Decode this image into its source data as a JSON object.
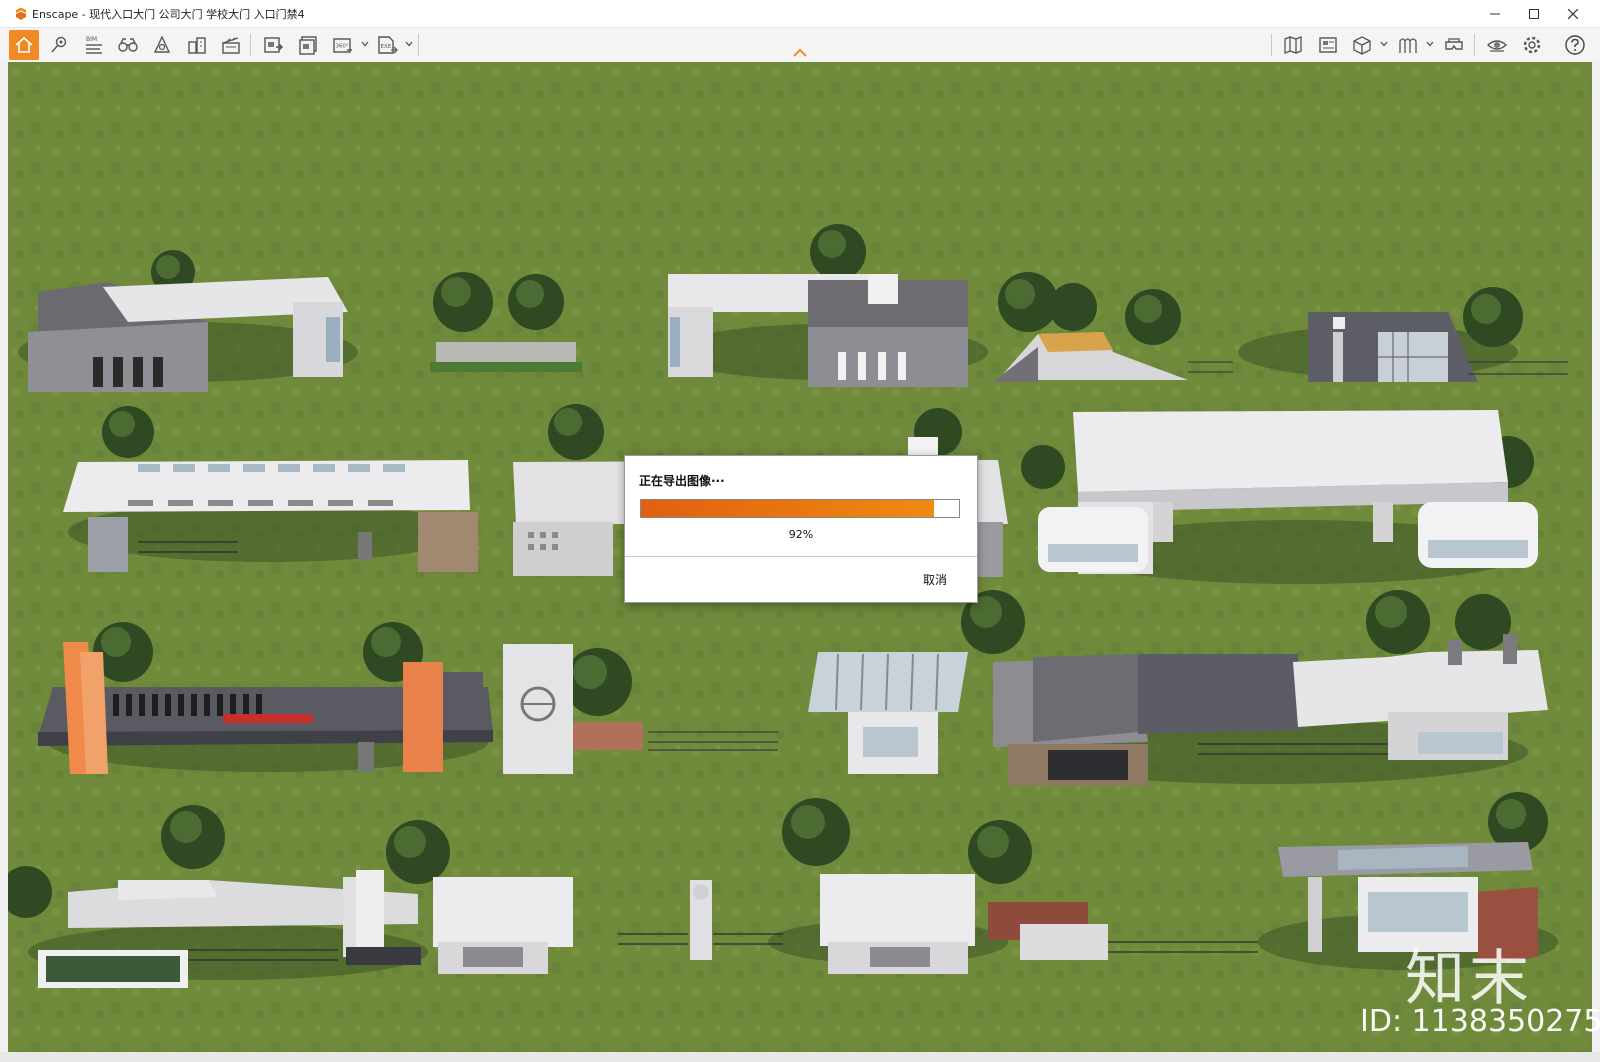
{
  "window": {
    "app_name": "Enscape",
    "title": "Enscape - 现代入口大门 公司大门 学校大门 入口门禁4",
    "minimize_icon": "minimize-icon",
    "maximize_icon": "maximize-icon",
    "close_icon": "close-icon"
  },
  "toolbar": {
    "bim_label": "BIM",
    "panorama_label": "360°",
    "exe_label": "EXE",
    "left_icons": [
      "home-icon",
      "location-pin-icon",
      "bim-icon",
      "binoculars-icon",
      "light-icon",
      "buildings-icon",
      "clapperboard-icon",
      "screenshot-export-icon",
      "batch-export-icon",
      "panorama-icon",
      "exe-export-icon"
    ],
    "right_icons": [
      "map-icon",
      "material-editor-icon",
      "cube-icon",
      "asset-library-icon",
      "vr-headset-icon",
      "visibility-icon",
      "settings-icon",
      "help-icon"
    ]
  },
  "dialog": {
    "title": "正在导出图像···",
    "progress_text": "92%",
    "progress_value": 0.92,
    "cancel_label": "取消"
  },
  "watermark": {
    "logo_text": "知末",
    "id_text": "ID: 1138350275"
  },
  "colors": {
    "accent": "#f08a24",
    "progress_start": "#e06010",
    "progress_end": "#f08a10",
    "grass": "#6f8a3a"
  }
}
